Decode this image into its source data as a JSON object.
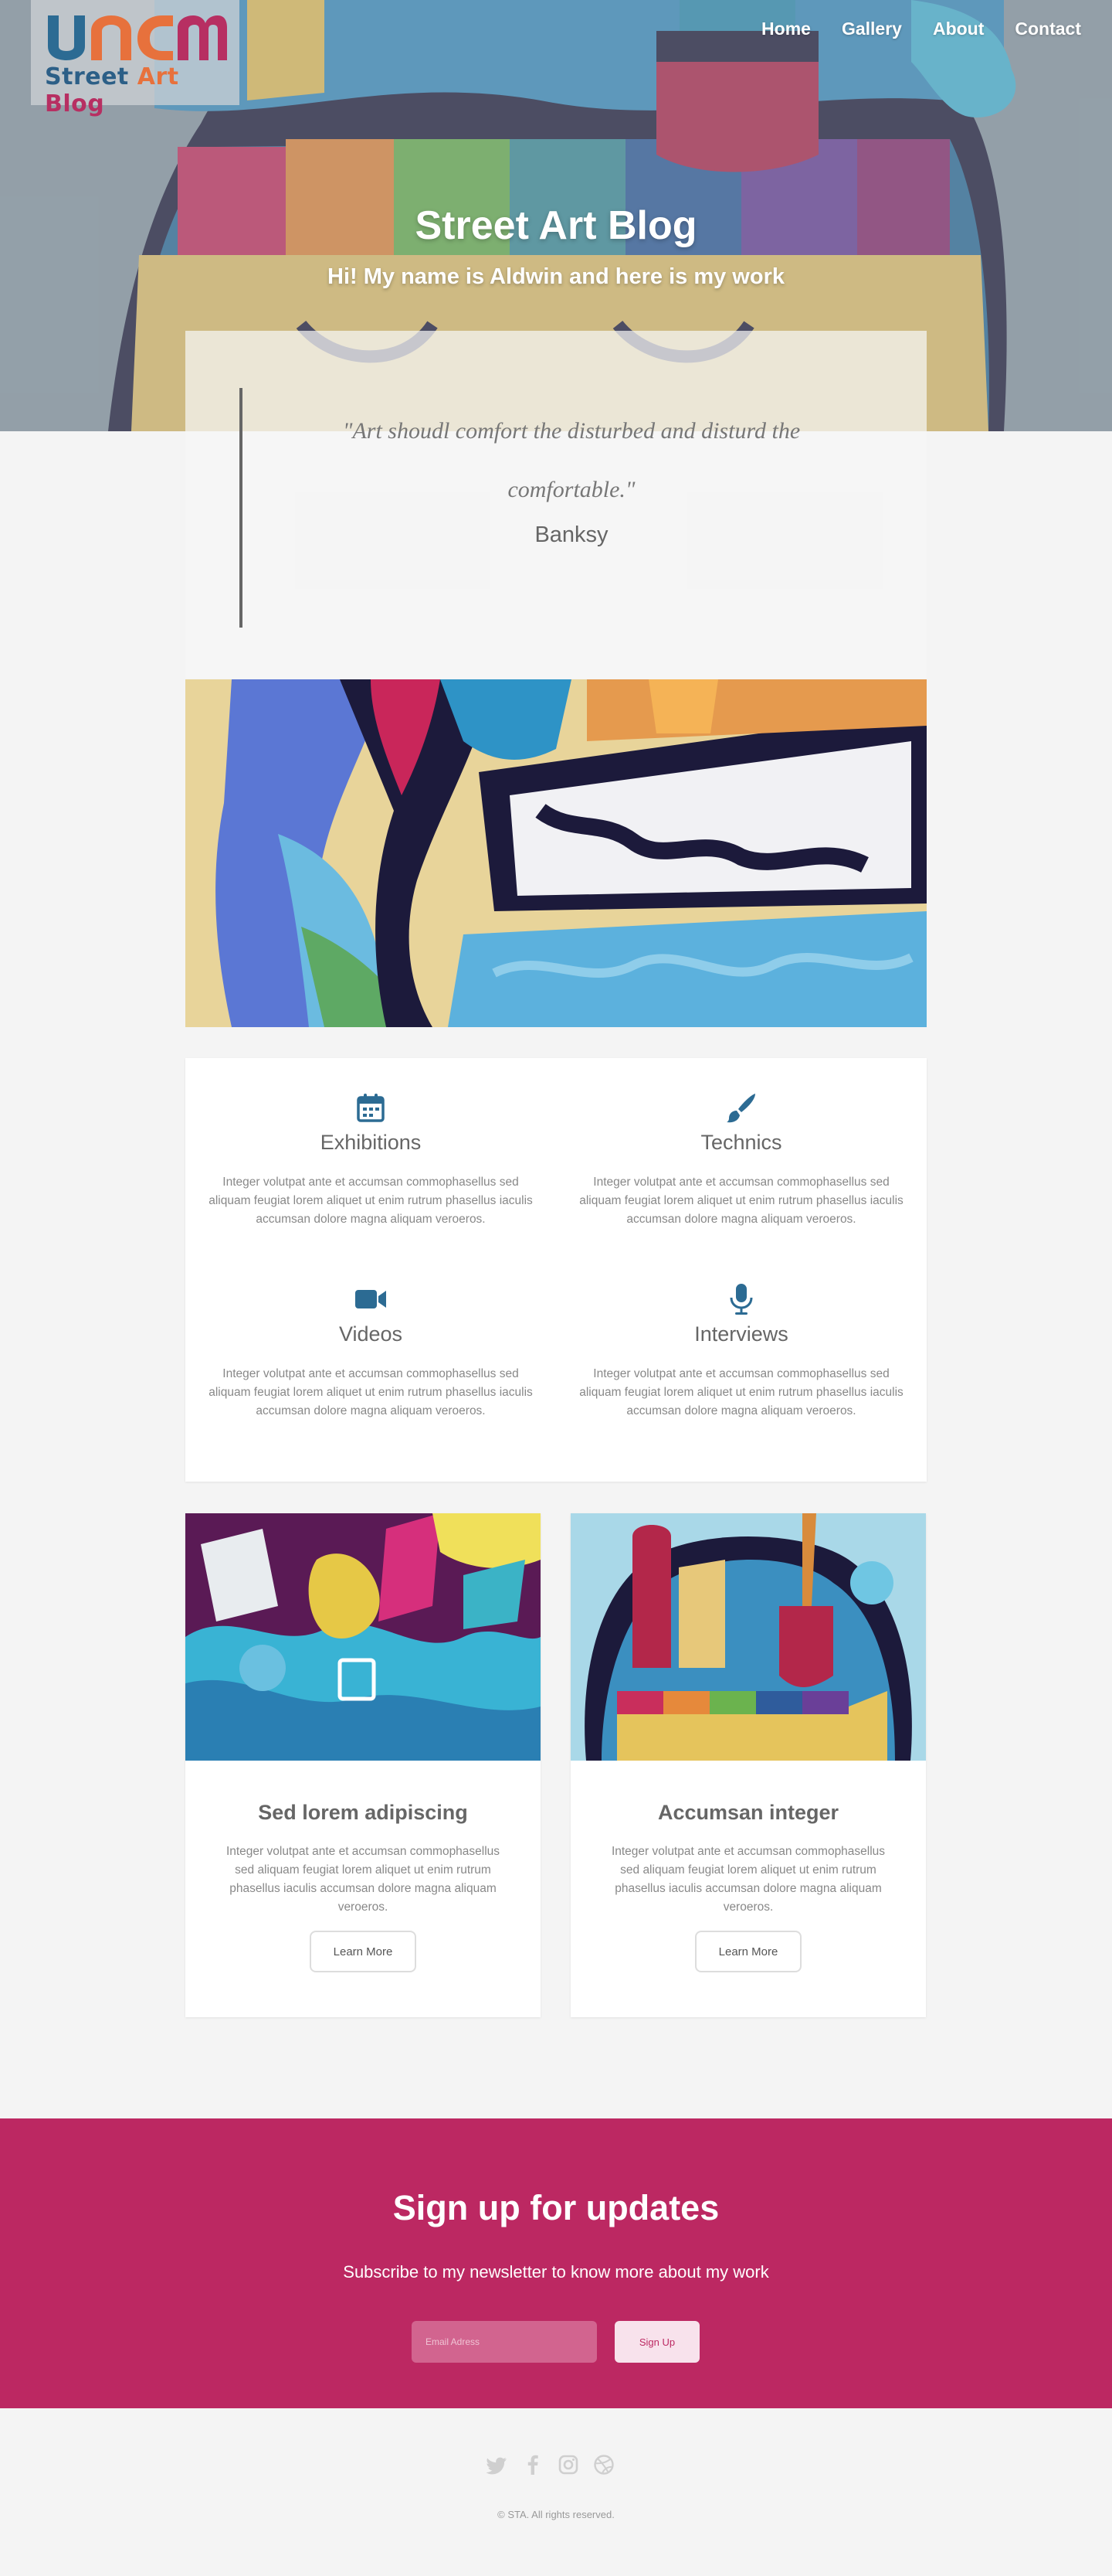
{
  "brand": {
    "logo_text_part1": "Street ",
    "logo_text_part2": "Art",
    "logo_text_part3": " Blog",
    "logo_colors": [
      "#2c5f87",
      "#e7713c",
      "#b72f62"
    ]
  },
  "nav": {
    "items": [
      {
        "label": "Home"
      },
      {
        "label": "Gallery"
      },
      {
        "label": "About"
      },
      {
        "label": "Contact"
      }
    ]
  },
  "hero": {
    "title": "Street Art Blog",
    "subtitle": "Hi! My name is Aldwin and here is my work"
  },
  "quote": {
    "text": "\"Art shoudl comfort the disturbed and disturd the comfortable.\"",
    "author": "Banksy"
  },
  "services": [
    {
      "icon": "calendar-icon",
      "title": "Exhibitions",
      "text": "Integer volutpat ante et accumsan commophasellus sed aliquam feugiat lorem aliquet ut enim rutrum phasellus iaculis accumsan dolore magna aliquam veroeros."
    },
    {
      "icon": "brush-icon",
      "title": "Technics",
      "text": "Integer volutpat ante et accumsan commophasellus sed aliquam feugiat lorem aliquet ut enim rutrum phasellus iaculis accumsan dolore magna aliquam veroeros."
    },
    {
      "icon": "video-camera-icon",
      "title": "Videos",
      "text": "Integer volutpat ante et accumsan commophasellus sed aliquam feugiat lorem aliquet ut enim rutrum phasellus iaculis accumsan dolore magna aliquam veroeros."
    },
    {
      "icon": "microphone-icon",
      "title": "Interviews",
      "text": "Integer volutpat ante et accumsan commophasellus sed aliquam feugiat lorem aliquet ut enim rutrum phasellus iaculis accumsan dolore magna aliquam veroeros."
    }
  ],
  "cards": [
    {
      "title": "Sed lorem adipiscing",
      "text": "Integer volutpat ante et accumsan commophasellus sed aliquam feugiat lorem aliquet ut enim rutrum phasellus iaculis accumsan dolore magna aliquam veroeros.",
      "button": "Learn More"
    },
    {
      "title": "Accumsan integer",
      "text": "Integer volutpat ante et accumsan commophasellus sed aliquam feugiat lorem aliquet ut enim rutrum phasellus iaculis accumsan dolore magna aliquam veroeros.",
      "button": "Learn More"
    }
  ],
  "signup": {
    "title": "Sign up for updates",
    "subtitle": "Subscribe to my newsletter to know more about my work",
    "email_placeholder": "Email Adress",
    "button": "Sign Up",
    "accent": "#bc2862"
  },
  "footer": {
    "social_icons": [
      "twitter-icon",
      "facebook-icon",
      "instagram-icon",
      "dribbble-icon"
    ],
    "copyright": "© STA. All rights reserved."
  }
}
